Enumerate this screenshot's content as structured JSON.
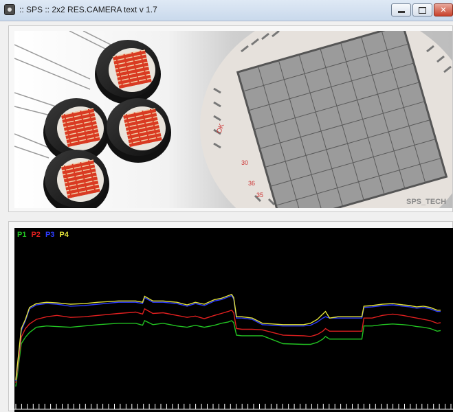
{
  "window": {
    "title": ":: SPS :: 2x2 RES.CAMERA text v 1.7",
    "app_icon": "camera-icon"
  },
  "banner": {
    "watermark": "SPS_TECH",
    "pin_labels": [
      "OK",
      "30",
      "36",
      "35"
    ]
  },
  "colors": {
    "P1": "#22c322",
    "P2": "#e01f1f",
    "P3": "#2d3cff",
    "P4": "#e3e33a"
  },
  "chart_data": {
    "type": "line",
    "legend": [
      "P1",
      "P2",
      "P3",
      "P4"
    ],
    "x_range": [
      0,
      620
    ],
    "y_range": [
      0,
      240
    ],
    "grid": false,
    "series": [
      {
        "name": "P1",
        "x": [
          0,
          8,
          14,
          20,
          30,
          45,
          60,
          80,
          100,
          120,
          150,
          175,
          185,
          188,
          200,
          215,
          235,
          250,
          262,
          275,
          290,
          300,
          310,
          315,
          318,
          322,
          330,
          345,
          360,
          390,
          420,
          430,
          440,
          448,
          452,
          458,
          470,
          490,
          505,
          508,
          520,
          535,
          550,
          565,
          575,
          585,
          595,
          605,
          615,
          620
        ],
        "y": [
          20,
          85,
          95,
          102,
          110,
          112,
          111,
          110,
          112,
          114,
          116,
          116,
          113,
          120,
          114,
          116,
          112,
          110,
          113,
          110,
          113,
          116,
          118,
          120,
          117,
          98,
          97,
          97,
          97,
          85,
          84,
          84,
          87,
          92,
          96,
          92,
          92,
          92,
          92,
          112,
          112,
          114,
          115,
          114,
          113,
          111,
          110,
          108,
          104,
          105
        ]
      },
      {
        "name": "P2",
        "x": [
          0,
          8,
          14,
          20,
          30,
          45,
          60,
          80,
          100,
          120,
          150,
          175,
          185,
          188,
          200,
          215,
          235,
          250,
          262,
          275,
          290,
          300,
          310,
          315,
          318,
          322,
          330,
          345,
          360,
          390,
          420,
          430,
          440,
          448,
          452,
          458,
          470,
          490,
          505,
          508,
          520,
          535,
          550,
          565,
          575,
          585,
          595,
          605,
          615,
          620
        ],
        "y": [
          25,
          95,
          108,
          115,
          122,
          126,
          128,
          125,
          126,
          128,
          131,
          133,
          130,
          138,
          131,
          132,
          128,
          125,
          127,
          123,
          128,
          131,
          134,
          136,
          132,
          108,
          107,
          107,
          106,
          98,
          97,
          96,
          99,
          104,
          108,
          104,
          104,
          104,
          104,
          124,
          124,
          128,
          130,
          128,
          126,
          124,
          122,
          120,
          116,
          117
        ]
      },
      {
        "name": "P3",
        "x": [
          0,
          8,
          14,
          20,
          30,
          45,
          60,
          80,
          100,
          120,
          150,
          175,
          185,
          188,
          200,
          215,
          235,
          250,
          262,
          275,
          290,
          300,
          310,
          315,
          318,
          322,
          330,
          345,
          360,
          390,
          420,
          430,
          440,
          448,
          452,
          458,
          470,
          490,
          505,
          508,
          520,
          535,
          550,
          565,
          575,
          585,
          595,
          605,
          615,
          620
        ],
        "y": [
          28,
          105,
          120,
          138,
          144,
          146,
          145,
          142,
          143,
          145,
          148,
          148,
          146,
          155,
          148,
          148,
          146,
          142,
          146,
          143,
          150,
          152,
          156,
          158,
          153,
          124,
          124,
          122,
          114,
          112,
          112,
          113,
          118,
          124,
          126,
          124,
          124,
          124,
          124,
          140,
          141,
          143,
          144,
          142,
          141,
          139,
          140,
          138,
          134,
          134
        ]
      },
      {
        "name": "P4",
        "x": [
          0,
          8,
          14,
          20,
          30,
          45,
          60,
          80,
          100,
          120,
          150,
          175,
          185,
          188,
          200,
          215,
          235,
          250,
          262,
          275,
          290,
          300,
          310,
          315,
          318,
          322,
          330,
          345,
          360,
          390,
          420,
          430,
          440,
          448,
          452,
          458,
          470,
          490,
          505,
          508,
          520,
          535,
          550,
          565,
          575,
          585,
          595,
          605,
          615,
          620
        ],
        "y": [
          30,
          108,
          122,
          140,
          146,
          148,
          147,
          145,
          146,
          148,
          150,
          150,
          148,
          157,
          150,
          150,
          148,
          144,
          148,
          145,
          152,
          154,
          158,
          160,
          155,
          126,
          126,
          124,
          116,
          114,
          114,
          116,
          122,
          130,
          134,
          124,
          126,
          126,
          126,
          142,
          143,
          145,
          146,
          144,
          143,
          141,
          142,
          140,
          136,
          136
        ]
      }
    ],
    "x_ticks_count": 76
  }
}
